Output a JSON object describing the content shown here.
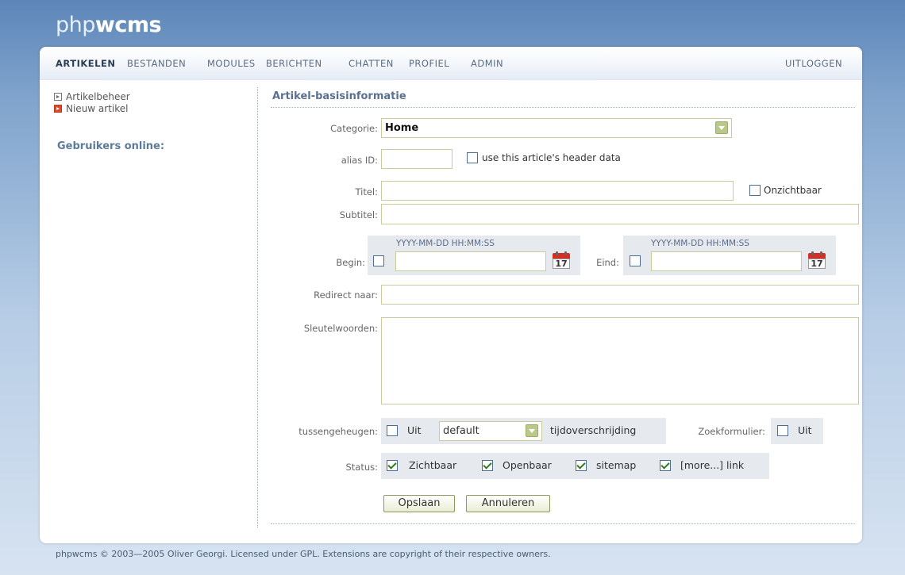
{
  "logo": {
    "light": "php",
    "bold": "wcms"
  },
  "topnav": {
    "items": [
      "ARTIKELEN",
      "BESTANDEN",
      "MODULES",
      "BERICHTEN",
      "CHATTEN",
      "PROFIEL",
      "ADMIN"
    ],
    "logout": "UITLOGGEN"
  },
  "sidebar": {
    "links": [
      "Artikelbeheer",
      "Nieuw artikel"
    ],
    "online_title": "Gebruikers online:"
  },
  "form": {
    "section_title": "Artikel-basisinformatie",
    "categorie_label": "Categorie:",
    "categorie_value": "Home",
    "alias_label": "alias ID:",
    "alias_value": "",
    "header_data_label": "use this article's header data",
    "titel_label": "Titel:",
    "titel_value": "",
    "onzichtbaar_label": "Onzichtbaar",
    "subtitel_label": "Subtitel:",
    "subtitel_value": "",
    "date_hint": "YYYY-MM-DD HH:MM:SS",
    "begin_label": "Begin:",
    "eind_label": "Eind:",
    "calendar_day": "17",
    "redirect_label": "Redirect naar:",
    "redirect_value": "",
    "sleutel_label": "Sleutelwoorden:",
    "sleutel_value": "",
    "cache_label": "tussengeheugen:",
    "uit_label": "Uit",
    "cache_select": "default",
    "timeout_label": "tijdoverschrijding",
    "zoek_label": "Zoekformulier:",
    "status_label": "Status:",
    "status_items": [
      "Zichtbaar",
      "Openbaar",
      "sitemap",
      "[more...] link"
    ],
    "save_label": "Opslaan",
    "cancel_label": "Annuleren"
  },
  "footer": "phpwcms © 2003—2005 Oliver Georgi. Licensed under GPL. Extensions are copyright of their respective owners."
}
